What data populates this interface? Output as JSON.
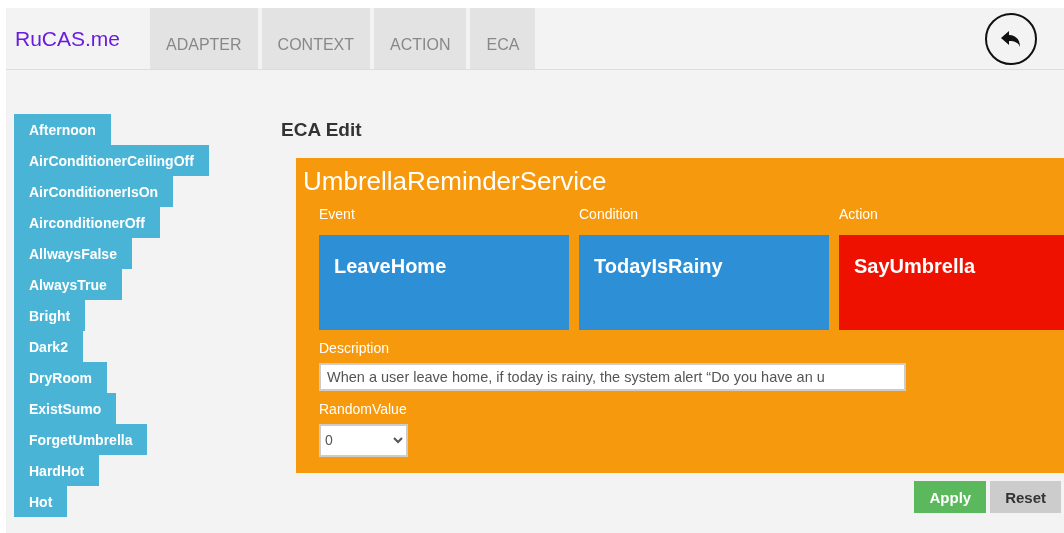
{
  "navbar": {
    "brand": "RuCAS.me",
    "tabs": [
      {
        "label": "ADAPTER",
        "selected": false
      },
      {
        "label": "CONTEXT",
        "selected": false
      },
      {
        "label": "ACTION",
        "selected": false
      },
      {
        "label": "ECA",
        "selected": false
      }
    ]
  },
  "sidebar": {
    "items": [
      "Afternoon",
      "AirConditionerCeilingOff",
      "AirConditionerIsOn",
      "AirconditionerOff",
      "AllwaysFalse",
      "AlwaysTrue",
      "Bright",
      "Dark2",
      "DryRoom",
      "ExistSumo",
      "ForgetUmbrella",
      "HardHot",
      "Hot"
    ]
  },
  "heading": "ECA Edit",
  "eca": {
    "name": "UmbrellaReminderService",
    "parts": [
      {
        "label": "Event",
        "value": "LeaveHome",
        "color": "#2d8fd5"
      },
      {
        "label": "Condition",
        "value": "TodayIsRainy",
        "color": "#2d8fd5"
      },
      {
        "label": "Action",
        "value": "SayUmbrella",
        "color": "#ee1100"
      }
    ],
    "description_label": "Description",
    "description": "When a user leave home, if today is rainy, the system alert “Do you have an u",
    "random_label": "RandomValue",
    "random_value": "0"
  },
  "buttons": [
    {
      "label": "Apply",
      "kind": "primary"
    },
    {
      "label": "Reset",
      "kind": "secondary"
    }
  ]
}
